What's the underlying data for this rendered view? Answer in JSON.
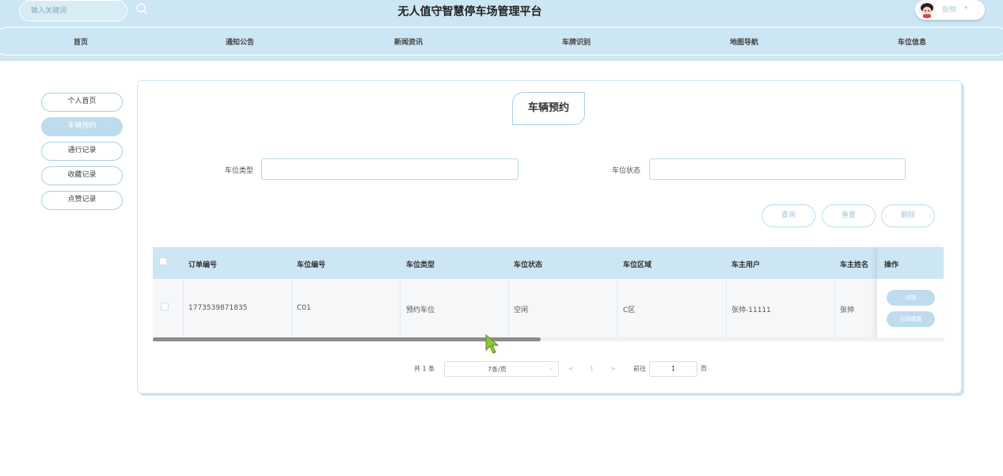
{
  "header": {
    "search_placeholder": "输入关键词",
    "site_title": "无人值守智慧停车场管理平台",
    "user_name": "张帅",
    "user_caret": "▾"
  },
  "nav": {
    "items": [
      {
        "label": "首页"
      },
      {
        "label": "通知公告"
      },
      {
        "label": "新闻资讯"
      },
      {
        "label": "车牌识别"
      },
      {
        "label": "地图导航"
      },
      {
        "label": "车位信息"
      }
    ]
  },
  "sidebar": {
    "items": [
      {
        "label": "个人首页",
        "active": false
      },
      {
        "label": "车辆预约",
        "active": true
      },
      {
        "label": "通行记录",
        "active": false
      },
      {
        "label": "收藏记录",
        "active": false
      },
      {
        "label": "点赞记录",
        "active": false
      }
    ]
  },
  "panel": {
    "title": "车辆预约"
  },
  "filters": {
    "type_label": "车位类型",
    "type_value": "",
    "status_label": "车位状态",
    "status_value": ""
  },
  "actions": {
    "query": "查询",
    "reset": "重置",
    "delete": "删除"
  },
  "table": {
    "columns": [
      "订单编号",
      "车位编号",
      "车位类型",
      "车位状态",
      "车位区域",
      "车主用户",
      "车主姓名",
      "操作"
    ],
    "rows": [
      {
        "order_no": "1773539871835",
        "space_no": "C01",
        "space_type": "预约车位",
        "space_status": "空闲",
        "space_area": "C区",
        "owner_user": "张帅-11111",
        "owner_name": "张帅",
        "detail_label": "详情",
        "exit_label": "出场缴费"
      }
    ]
  },
  "pagination": {
    "total_text": "共 1 条",
    "page_size": "7条/页",
    "prev": "<",
    "current_page": "1",
    "next": ">",
    "goto_label": "前往",
    "goto_value": "1",
    "page_unit": "页"
  },
  "colors": {
    "header_bg": "#cde6f3",
    "accent_border": "#a8cfe3",
    "active_fill": "#bedcee"
  }
}
